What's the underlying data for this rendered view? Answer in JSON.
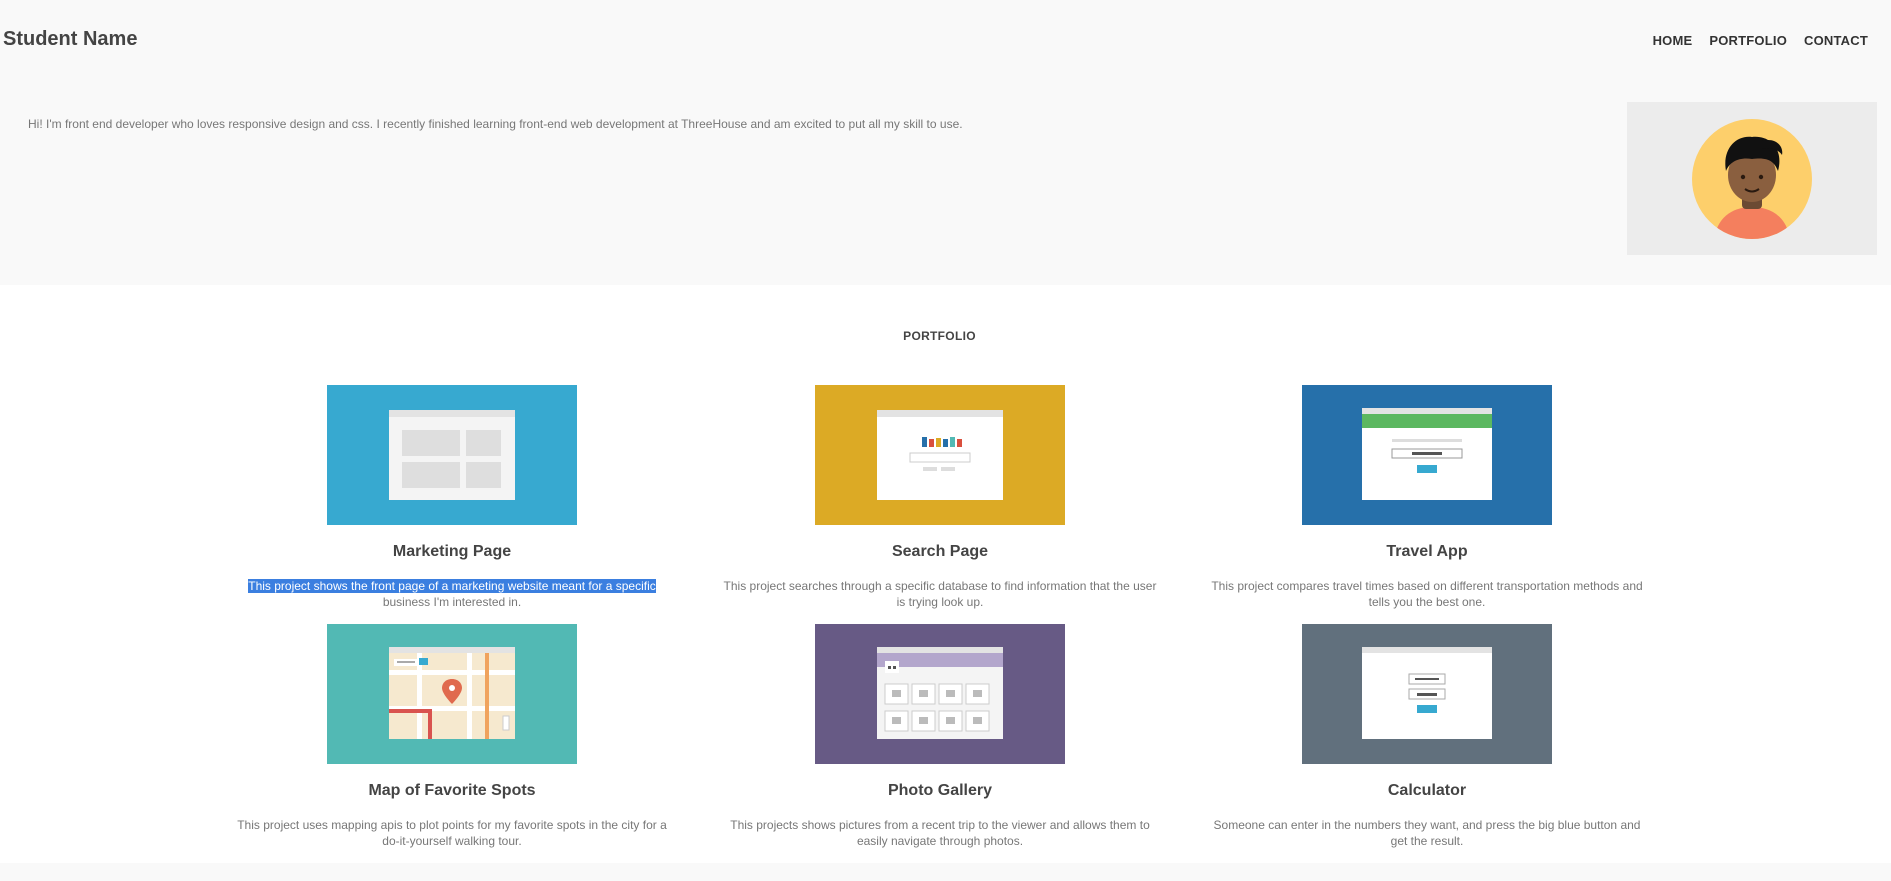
{
  "header": {
    "brand": "Student Name",
    "nav": [
      "HOME",
      "PORTFOLIO",
      "CONTACT"
    ],
    "bio": "Hi! I'm front end developer who loves responsive design and css. I recently finished learning front-end web development at ThreeHouse and am excited to put all my skill to use."
  },
  "portfolio": {
    "title": "PORTFOLIO",
    "projects": [
      {
        "title": "Marketing Page",
        "desc_highlighted": "This project shows the front page of a marketing website meant for a specific",
        "desc_rest": " business I'm interested in.",
        "color": "#37a9d0"
      },
      {
        "title": "Search Page",
        "desc": "This project searches through a specific database to find information that the user is trying look up.",
        "color": "#dcaa25"
      },
      {
        "title": "Travel App",
        "desc": "This project compares travel times based on different transportation methods and tells you the best one.",
        "color": "#2670aa"
      },
      {
        "title": "Map of Favorite Spots",
        "desc": "This project uses mapping apis to plot points for my favorite spots in the city for a do-it-yourself walking tour.",
        "color": "#52b9b4"
      },
      {
        "title": "Photo Gallery",
        "desc": "This projects shows pictures from a recent trip to the viewer and allows them to easily navigate through photos.",
        "color": "#675a85"
      },
      {
        "title": "Calculator",
        "desc": "Someone can enter in the numbers they want, and press the big blue button and get the result.",
        "color": "#61707d"
      }
    ]
  }
}
